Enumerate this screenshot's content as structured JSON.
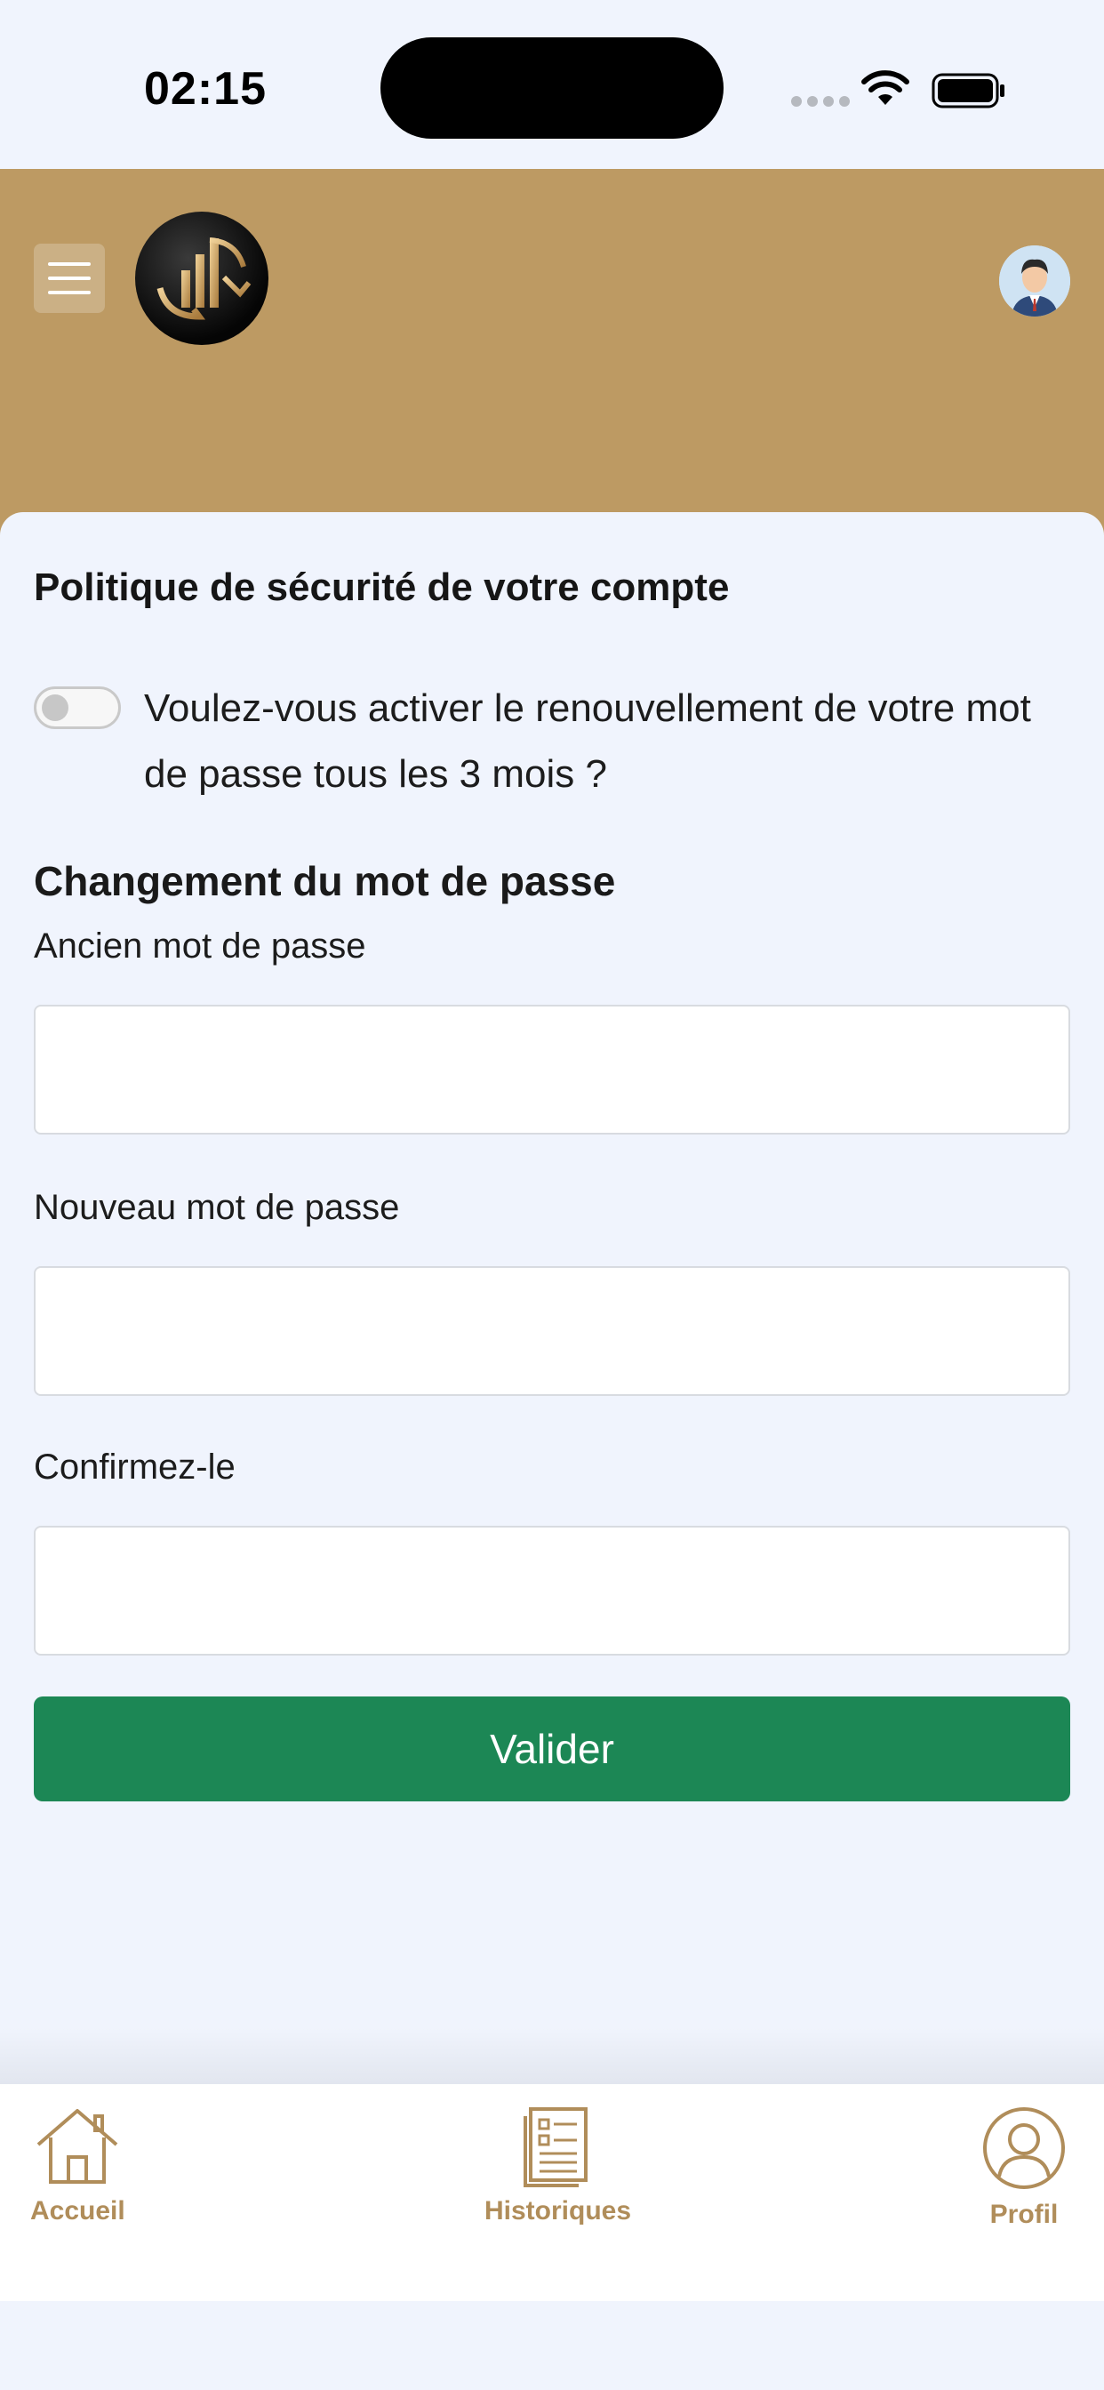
{
  "status_bar": {
    "time": "02:15",
    "icons": [
      "cellular-signal-icon",
      "wifi-icon",
      "battery-icon"
    ]
  },
  "header": {
    "menu_icon": "hamburger-menu-icon",
    "logo": "app-logo",
    "avatar_icon": "user-avatar-icon",
    "color": "#bd9a63"
  },
  "security_policy": {
    "title": "Politique de sécurité de votre compte",
    "toggle_text": "Voulez-vous activer le renouvellement de votre mot de passe tous les 3 mois ?",
    "toggle_on": false
  },
  "password_change": {
    "title": "Changement du mot de passe",
    "old_password_label": "Ancien mot de passe",
    "old_password_value": "",
    "new_password_label": "Nouveau mot de passe",
    "new_password_value": "",
    "confirm_label": "Confirmez-le",
    "confirm_value": "",
    "submit_label": "Valider",
    "submit_color": "#1c8755"
  },
  "bottom_nav": {
    "accent_color": "#b08d5a",
    "items": [
      {
        "label": "Accueil",
        "icon": "home-icon"
      },
      {
        "label": "Historiques",
        "icon": "document-list-icon"
      },
      {
        "label": "Profil",
        "icon": "profile-icon"
      }
    ]
  }
}
